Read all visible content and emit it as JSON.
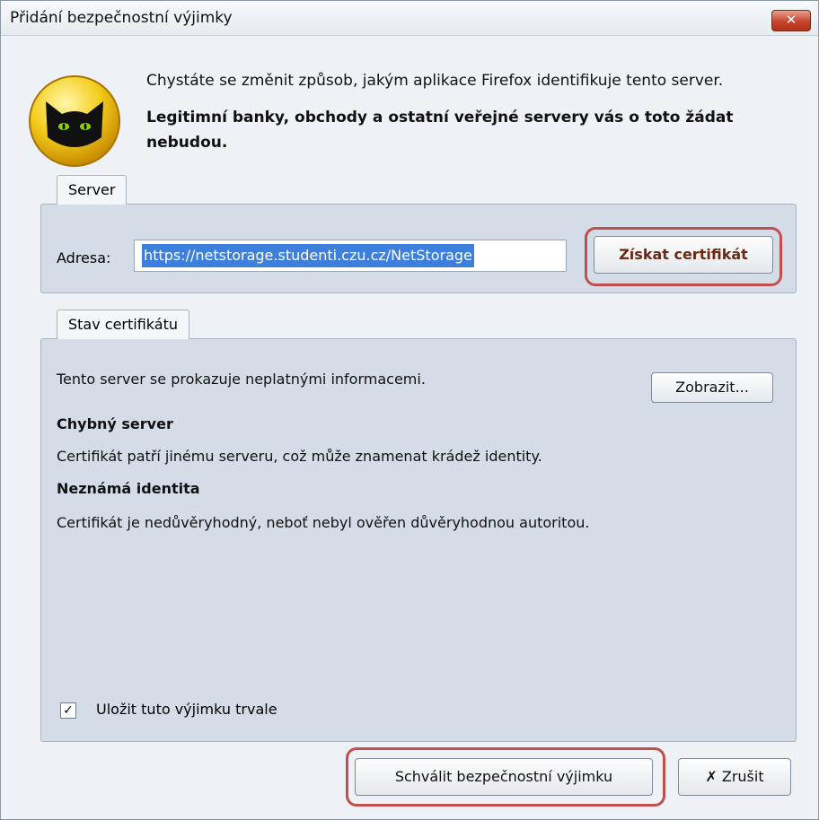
{
  "window": {
    "title": "Přidání bezpečnostní výjimky",
    "close_glyph": "✕"
  },
  "message": {
    "line1": "Chystáte se změnit způsob, jakým aplikace Firefox identifikuje tento server.",
    "line2": "Legitimní banky, obchody a ostatní veřejné servery vás o toto žádat nebudou.",
    "icon": "black-cat-warning-icon"
  },
  "server": {
    "group_label": "Server",
    "address_label": "Adresa:",
    "address_value": "https://netstorage.studenti.czu.cz/NetStorage",
    "get_cert_button": "Získat certifikát"
  },
  "status": {
    "group_label": "Stav certifikátu",
    "summary": "Tento server se prokazuje neplatnými informacemi.",
    "view_button": "Zobrazit...",
    "issue1_title": "Chybný server",
    "issue1_text": "Certifikát patří jinému serveru, což může znamenat krádež identity.",
    "issue2_title": "Neznámá identita",
    "issue2_text": "Certifikát je nedůvěryhodný, neboť nebyl ověřen důvěryhodnou autoritou."
  },
  "save_permanently": {
    "label": "Uložit tuto výjimku trvale",
    "checked": true,
    "check_glyph": "✓"
  },
  "footer": {
    "confirm_button": "Schválit bezpečnostní výjimku",
    "cancel_button": "Zrušit",
    "cancel_glyph": "✗"
  },
  "colors": {
    "highlight": "#c0504d",
    "selection": "#3d7fdc"
  }
}
